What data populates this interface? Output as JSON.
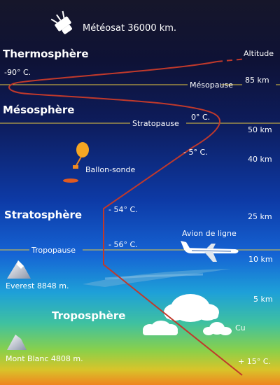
{
  "satellite": {
    "label": "Météosat 36000 km.",
    "icon": "satellite-icon"
  },
  "layers": {
    "thermosphere": "Thermosphère",
    "mesosphere": "Mésosphère",
    "stratosphere": "Stratosphère",
    "troposphere": "Troposphère"
  },
  "boundaries": {
    "mesopause": "Mésopause",
    "stratopause": "Stratopause",
    "tropopause": "Tropopause"
  },
  "altitude_axis": {
    "title": "Altitude",
    "ticks": [
      "85 km",
      "50 km",
      "40 km",
      "25 km",
      "10 km",
      "5 km"
    ]
  },
  "temperatures": {
    "t_mesopause": "-90° C.",
    "t_stratopause": "0° C.",
    "t_40km": "- 5° C.",
    "t_25km": "- 54° C.",
    "t_tropopause": "- 56° C.",
    "t_ground": "+ 15° C."
  },
  "objects": {
    "balloon": "Ballon-sonde",
    "airliner": "Avion de ligne",
    "cumulus": "Cu",
    "everest": "Everest 8848 m.",
    "mont_blanc": "Mont Blanc 4808 m."
  },
  "colors": {
    "temperature_curve": "#c0392b",
    "boundary_lines": "#e8c840",
    "balloon": "#f5a623"
  }
}
